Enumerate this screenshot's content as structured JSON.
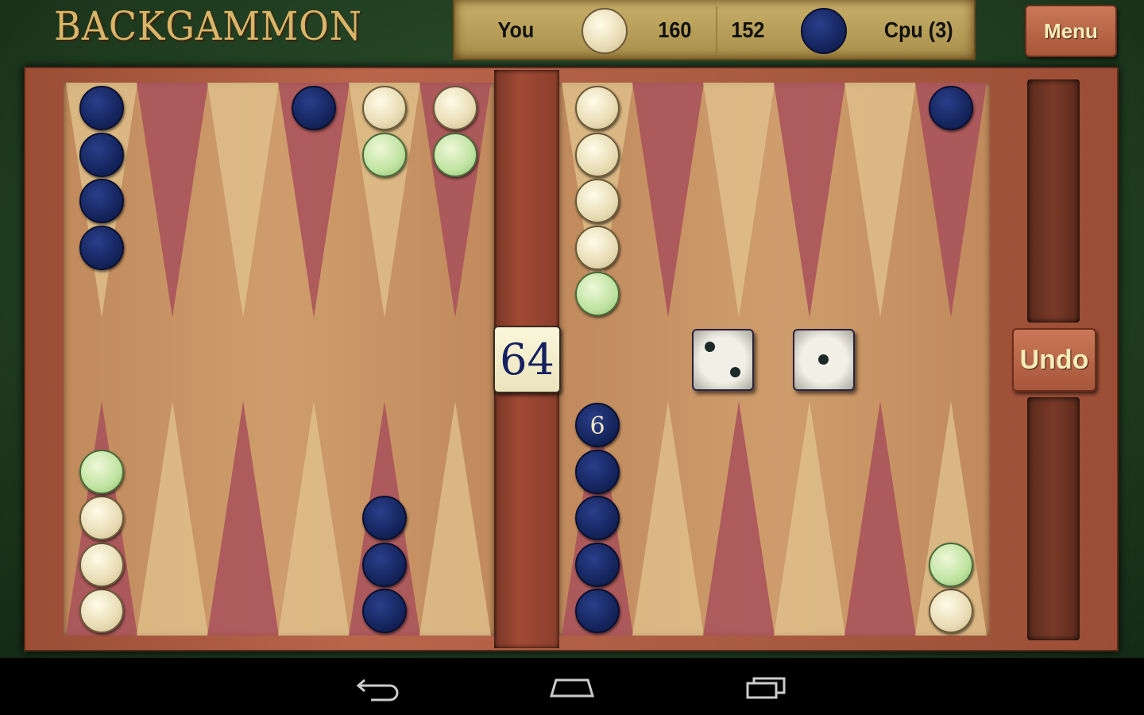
{
  "title": "BACKGAMMON",
  "score_bar": {
    "player_label": "You",
    "player_pips": "160",
    "cpu_pips": "152",
    "cpu_label": "Cpu (3)"
  },
  "buttons": {
    "menu": "Menu",
    "undo": "Undo"
  },
  "doubling_cube": "64",
  "dice": [
    2,
    1
  ],
  "colors": {
    "player": "#e8dcb4",
    "cpu": "#15255e",
    "highlight": "#bfe3a0",
    "dark_point": "#a8505a",
    "light_point": "#e2c48e"
  },
  "board": {
    "top": [
      {
        "point": 0,
        "checkers": [
          "blue",
          "blue",
          "blue",
          "blue"
        ]
      },
      {
        "point": 3,
        "checkers": [
          "blue"
        ]
      },
      {
        "point": 4,
        "checkers": [
          "white",
          "green"
        ]
      },
      {
        "point": 5,
        "checkers": [
          "white",
          "green"
        ]
      },
      {
        "point": 6,
        "checkers": [
          "white",
          "white",
          "white",
          "white",
          "green"
        ]
      },
      {
        "point": 11,
        "checkers": [
          "blue"
        ]
      }
    ],
    "bottom": [
      {
        "point": 0,
        "checkers": [
          "white",
          "white",
          "white",
          "green"
        ]
      },
      {
        "point": 4,
        "checkers": [
          "blue",
          "blue",
          "blue"
        ]
      },
      {
        "point": 6,
        "checkers": [
          "blue",
          "blue",
          "blue",
          "blue",
          "blue"
        ],
        "count_label": "6"
      },
      {
        "point": 11,
        "checkers": [
          "white",
          "green"
        ]
      }
    ]
  },
  "navbar": {
    "icons": [
      "back-icon",
      "home-icon",
      "recent-apps-icon"
    ]
  }
}
